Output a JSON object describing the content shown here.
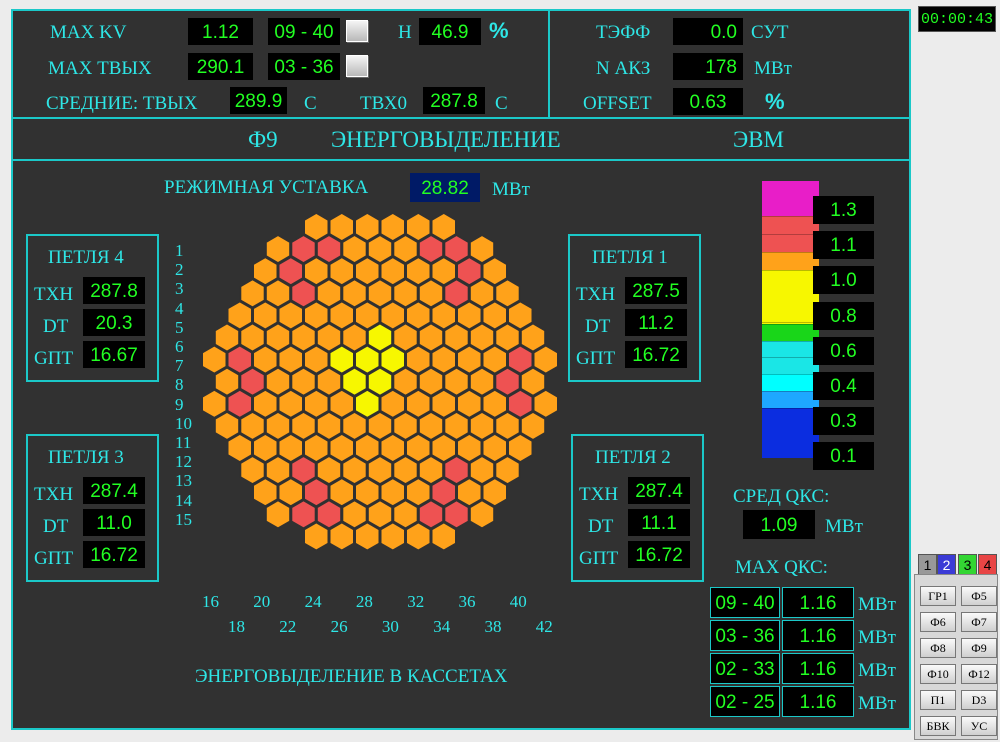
{
  "timer": "00:00:43",
  "top": {
    "max_kv_label": "MAX  KV",
    "max_kv_value": "1.12",
    "max_kv_pos": "09 - 40",
    "h_label": "H",
    "h_value": "46.9",
    "h_unit": "%",
    "max_tout_label": "MAX  ТВЫХ",
    "max_tout_value": "290.1",
    "max_tout_pos": "03 - 36",
    "avg_label": "СРЕДНИЕ:  ТВЫХ",
    "avg_tout_value": "289.9",
    "avg_tout_unit": "С",
    "tbx0_label": "ТВХ0",
    "tbx0_value": "287.8",
    "tbx0_unit": "С",
    "teff_label": "ТЭФФ",
    "teff_value": "0.0",
    "teff_unit": "СУТ",
    "nak3_label": "N АКЗ",
    "nak3_value": "178",
    "nak3_unit": "МВт",
    "offset_label": "OFFSET",
    "offset_value": "0.63",
    "offset_unit": "%"
  },
  "header": {
    "code": "Ф9",
    "title": "ЭНЕРГОВЫДЕЛЕНИЕ",
    "source": "ЭВМ"
  },
  "setpoint": {
    "label": "РЕЖИМНАЯ УСТАВКА",
    "value": "28.82",
    "unit": "МВт"
  },
  "loops": [
    {
      "title": "ПЕТЛЯ 4",
      "txh": "287.8",
      "dt": "20.3",
      "gpt": "16.67"
    },
    {
      "title": "ПЕТЛЯ 1",
      "txh": "287.5",
      "dt": "11.2",
      "gpt": "16.72"
    },
    {
      "title": "ПЕТЛЯ 3",
      "txh": "287.4",
      "dt": "11.0",
      "gpt": "16.72"
    },
    {
      "title": "ПЕТЛЯ 2",
      "txh": "287.4",
      "dt": "11.1",
      "gpt": "16.72"
    }
  ],
  "loop_labels": {
    "txh": "ТХН",
    "dt": "DT",
    "gpt": "GПТ"
  },
  "row_numbers": [
    "1",
    "2",
    "3",
    "4",
    "5",
    "6",
    "7",
    "8",
    "9",
    "10",
    "11",
    "12",
    "13",
    "14",
    "15"
  ],
  "col_numbers_top": [
    "16",
    "20",
    "24",
    "28",
    "32",
    "36",
    "40"
  ],
  "col_numbers_bottom": [
    "18",
    "22",
    "26",
    "30",
    "34",
    "38",
    "42"
  ],
  "map_caption": "ЭНЕРГОВЫДЕЛЕНИЕ В КАССЕТАХ",
  "core_map": {
    "row_counts": [
      6,
      9,
      10,
      11,
      12,
      13,
      14,
      13,
      14,
      13,
      12,
      11,
      10,
      9,
      6
    ],
    "highlight_cells": [
      {
        "row": 1,
        "col": 1,
        "level": "red"
      },
      {
        "row": 1,
        "col": 2,
        "level": "red"
      },
      {
        "row": 1,
        "col": 6,
        "level": "red"
      },
      {
        "row": 1,
        "col": 7,
        "level": "red"
      },
      {
        "row": 2,
        "col": 1,
        "level": "red"
      },
      {
        "row": 2,
        "col": 8,
        "level": "red"
      },
      {
        "row": 3,
        "col": 2,
        "level": "red"
      },
      {
        "row": 3,
        "col": 8,
        "level": "red"
      },
      {
        "row": 6,
        "col": 1,
        "level": "red"
      },
      {
        "row": 6,
        "col": 12,
        "level": "red"
      },
      {
        "row": 7,
        "col": 1,
        "level": "red"
      },
      {
        "row": 7,
        "col": 11,
        "level": "red"
      },
      {
        "row": 8,
        "col": 1,
        "level": "red"
      },
      {
        "row": 8,
        "col": 12,
        "level": "red"
      },
      {
        "row": 5,
        "col": 6,
        "level": "yellow"
      },
      {
        "row": 6,
        "col": 5,
        "level": "yellow"
      },
      {
        "row": 6,
        "col": 6,
        "level": "yellow"
      },
      {
        "row": 6,
        "col": 7,
        "level": "yellow"
      },
      {
        "row": 7,
        "col": 5,
        "level": "yellow"
      },
      {
        "row": 7,
        "col": 6,
        "level": "yellow"
      },
      {
        "row": 8,
        "col": 6,
        "level": "yellow"
      },
      {
        "row": 11,
        "col": 2,
        "level": "red"
      },
      {
        "row": 11,
        "col": 8,
        "level": "red"
      },
      {
        "row": 12,
        "col": 2,
        "level": "red"
      },
      {
        "row": 12,
        "col": 7,
        "level": "red"
      },
      {
        "row": 13,
        "col": 1,
        "level": "red"
      },
      {
        "row": 13,
        "col": 2,
        "level": "red"
      },
      {
        "row": 13,
        "col": 6,
        "level": "red"
      },
      {
        "row": 13,
        "col": 7,
        "level": "red"
      }
    ]
  },
  "color_scale": {
    "labels": [
      "1.3",
      "1.1",
      "1.0",
      "0.8",
      "0.6",
      "0.4",
      "0.3",
      "0.1"
    ],
    "bands": [
      "#e81ec8",
      "#ee5252",
      "#ee5252",
      "#ffa21a",
      "#f7f700",
      "#f7f700",
      "#19d619",
      "#1ae6e6",
      "#1ae6e6",
      "#00ffff",
      "#1ea7ff",
      "#0b2de0"
    ],
    "colors": {
      "base": "#ffa21a",
      "red": "#ee5252",
      "yellow": "#f7f700",
      "map_bg": "#313131"
    }
  },
  "avg_qkc": {
    "label": "СРЕД  QКС:",
    "value": "1.09",
    "unit": "МВт"
  },
  "max_qkc": {
    "label": "MAX  QКС:",
    "rows": [
      {
        "pos": "09 - 40",
        "value": "1.16",
        "unit": "МВт"
      },
      {
        "pos": "03 - 36",
        "value": "1.16",
        "unit": "МВт"
      },
      {
        "pos": "02 - 33",
        "value": "1.16",
        "unit": "МВт"
      },
      {
        "pos": "02 - 25",
        "value": "1.16",
        "unit": "МВт"
      }
    ]
  },
  "nav": {
    "tabs": [
      "1",
      "2",
      "3",
      "4"
    ],
    "buttons": [
      "ГР1",
      "Ф5",
      "Ф6",
      "Ф7",
      "Ф8",
      "Ф9",
      "Ф10",
      "Ф12",
      "П1",
      "D3",
      "БВК",
      "УС"
    ]
  }
}
